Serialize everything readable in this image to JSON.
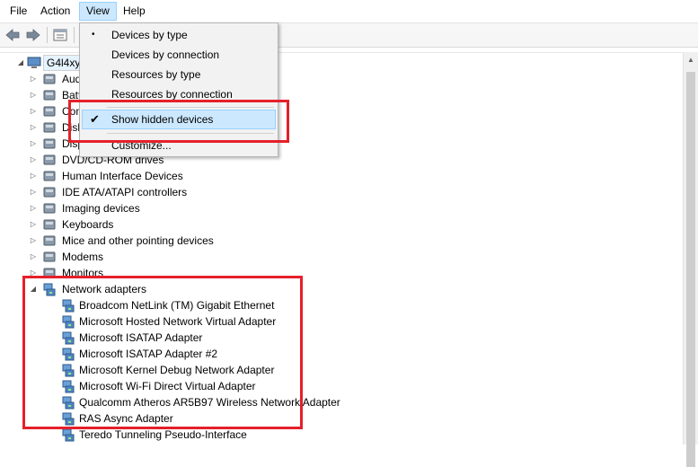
{
  "menubar": {
    "items": [
      "File",
      "Action",
      "View",
      "Help"
    ]
  },
  "toolbar": {
    "buttons": [
      "back-arrow-icon",
      "forward-arrow-icon",
      "properties-icon"
    ]
  },
  "view_menu": {
    "items": [
      {
        "label": "Devices by type",
        "marker": "•"
      },
      {
        "label": "Devices by connection",
        "marker": ""
      },
      {
        "label": "Resources by type",
        "marker": ""
      },
      {
        "label": "Resources by connection",
        "marker": ""
      },
      {
        "label": "Show hidden devices",
        "marker": "✔"
      },
      {
        "label": "Customize...",
        "marker": ""
      }
    ]
  },
  "tree": {
    "root": {
      "label": "G4l4xy",
      "expander": "◢"
    },
    "categories": [
      {
        "label": "Audio inputs and outputs",
        "expander": "▷"
      },
      {
        "label": "Batteries",
        "expander": "▷"
      },
      {
        "label": "Computer",
        "expander": "▷"
      },
      {
        "label": "Disk drives",
        "expander": "▷"
      },
      {
        "label": "Display adapters",
        "expander": "▷"
      },
      {
        "label": "DVD/CD-ROM drives",
        "expander": "▷"
      },
      {
        "label": "Human Interface Devices",
        "expander": "▷"
      },
      {
        "label": "IDE ATA/ATAPI controllers",
        "expander": "▷"
      },
      {
        "label": "Imaging devices",
        "expander": "▷"
      },
      {
        "label": "Keyboards",
        "expander": "▷"
      },
      {
        "label": "Mice and other pointing devices",
        "expander": "▷"
      },
      {
        "label": "Modems",
        "expander": "▷"
      },
      {
        "label": "Monitors",
        "expander": "▷"
      },
      {
        "label": "Network adapters",
        "expander": "◢"
      }
    ],
    "network_adapters": [
      "Broadcom NetLink (TM) Gigabit Ethernet",
      "Microsoft Hosted Network Virtual Adapter",
      "Microsoft ISATAP Adapter",
      "Microsoft ISATAP Adapter #2",
      "Microsoft Kernel Debug Network Adapter",
      "Microsoft Wi-Fi Direct Virtual Adapter",
      "Qualcomm Atheros AR5B97 Wireless Network Adapter",
      "RAS Async Adapter",
      "Teredo Tunneling Pseudo-Interface"
    ]
  },
  "colors": {
    "highlight_box": "#e5202a",
    "menu_hover": "#cce8ff"
  }
}
